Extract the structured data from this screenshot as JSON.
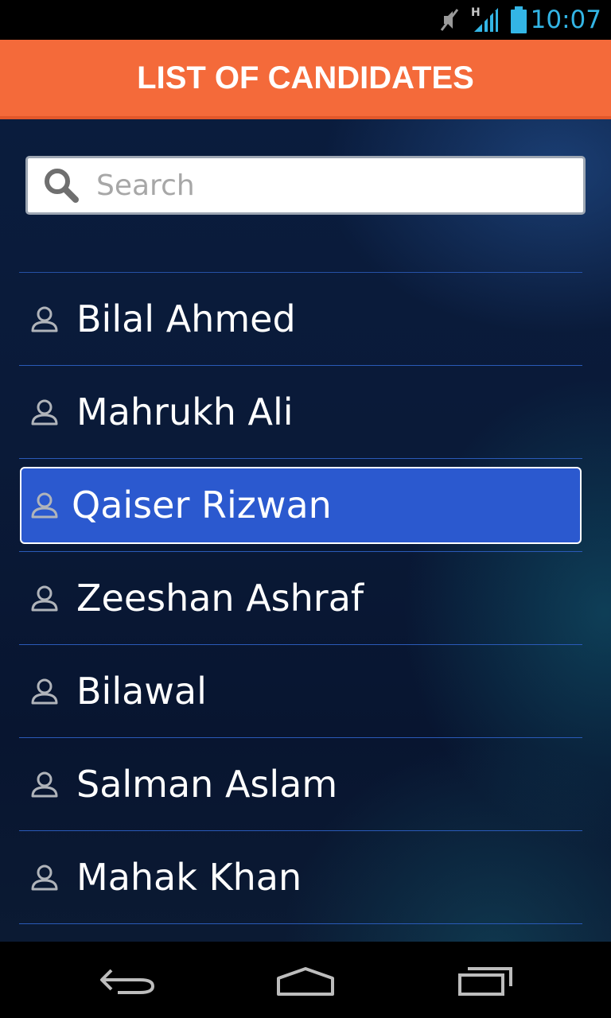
{
  "status_bar": {
    "time": "10:07",
    "network_type": "H",
    "icons": [
      "mute-icon",
      "signal-icon",
      "battery-icon"
    ]
  },
  "header": {
    "title": "LIST OF CANDIDATES"
  },
  "search": {
    "placeholder": "Search",
    "value": ""
  },
  "candidates": {
    "items": [
      {
        "name": "Bilal Ahmed",
        "selected": false
      },
      {
        "name": "Mahrukh Ali",
        "selected": false
      },
      {
        "name": "Qaiser Rizwan",
        "selected": true
      },
      {
        "name": "Zeeshan Ashraf",
        "selected": false
      },
      {
        "name": "Bilawal",
        "selected": false
      },
      {
        "name": "Salman Aslam",
        "selected": false
      },
      {
        "name": "Mahak Khan",
        "selected": false
      }
    ]
  },
  "nav_bar": {
    "icons": [
      "back-icon",
      "home-icon",
      "recent-apps-icon"
    ]
  },
  "colors": {
    "header_bg": "#f46a3a",
    "selected_bg": "#2b59cf",
    "clock": "#33b5e5",
    "divider": "#2a5ab8"
  }
}
